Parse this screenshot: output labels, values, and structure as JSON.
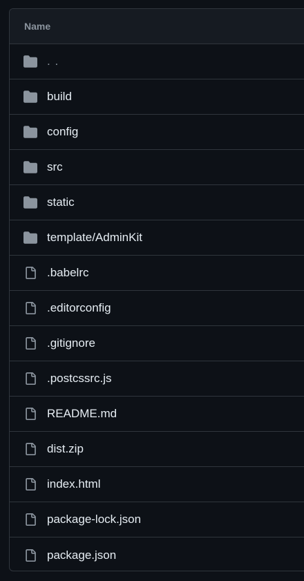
{
  "header": {
    "name_label": "Name"
  },
  "colors": {
    "background": "#0d1117",
    "header_background": "#161b22",
    "border": "#30363d",
    "folder_icon": "#8b949e",
    "file_icon": "#8b949e",
    "text": "#e6edf3",
    "muted_text": "#8b949e"
  },
  "rows": [
    {
      "type": "folder",
      "icon": "folder-icon",
      "name": ". ."
    },
    {
      "type": "folder",
      "icon": "folder-icon",
      "name": "build"
    },
    {
      "type": "folder",
      "icon": "folder-icon",
      "name": "config"
    },
    {
      "type": "folder",
      "icon": "folder-icon",
      "name": "src"
    },
    {
      "type": "folder",
      "icon": "folder-icon",
      "name": "static"
    },
    {
      "type": "folder",
      "icon": "folder-icon",
      "name": "template/AdminKit"
    },
    {
      "type": "file",
      "icon": "file-icon",
      "name": ".babelrc"
    },
    {
      "type": "file",
      "icon": "file-icon",
      "name": ".editorconfig"
    },
    {
      "type": "file",
      "icon": "file-icon",
      "name": ".gitignore"
    },
    {
      "type": "file",
      "icon": "file-icon",
      "name": ".postcssrc.js"
    },
    {
      "type": "file",
      "icon": "file-icon",
      "name": "README.md"
    },
    {
      "type": "file",
      "icon": "file-icon",
      "name": "dist.zip"
    },
    {
      "type": "file",
      "icon": "file-icon",
      "name": "index.html"
    },
    {
      "type": "file",
      "icon": "file-icon",
      "name": "package-lock.json"
    },
    {
      "type": "file",
      "icon": "file-icon",
      "name": "package.json"
    }
  ]
}
